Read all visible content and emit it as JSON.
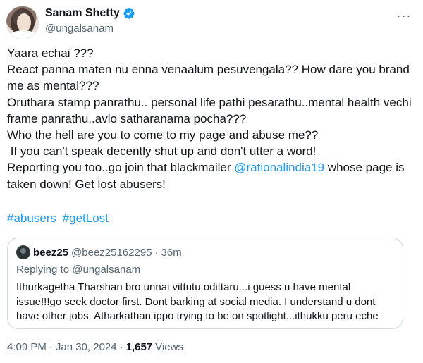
{
  "author": {
    "display_name": "Sanam Shetty",
    "handle": "@ungalsanam",
    "verified_color": "#1d9bf0"
  },
  "menu": {
    "more_label": "···"
  },
  "tweet": {
    "lines": [
      "Yaara echai ???",
      "React panna maten nu enna venaalum pesuvengala?? How dare you brand me as mental???",
      "Oruthara stamp panrathu.. personal life pathi pesarathu..mental health vechi frame panrathu..avlo satharanama pocha???",
      "Who the hell are you to come to my page and abuse me??",
      " If you can't speak decently shut up and don't utter a word!",
      "Reporting you too..go join that blackmailer @rationalindia19 whose page is taken down! Get lost abusers!"
    ],
    "hashtags": [
      "#abusers",
      "#getLost"
    ]
  },
  "quote": {
    "name": "beez25",
    "handle": "@beez25162295",
    "dot": "·",
    "time": "36m",
    "replying_to": "Replying to @ungalsanam",
    "text": "Ithurkagetha Tharshan bro unnai vittutu odittaru...i guess u have mental issue!!!go seek doctor first. Dont barking at social media. I understand u dont have other jobs. Atharkathan ippo trying to be on spotlight...ithukku peru eche"
  },
  "footer": {
    "time": "4:09 PM",
    "dot": "·",
    "date": "Jan 30, 2024",
    "dot2": "·",
    "views_count": "1,657",
    "views_label": "Views"
  }
}
